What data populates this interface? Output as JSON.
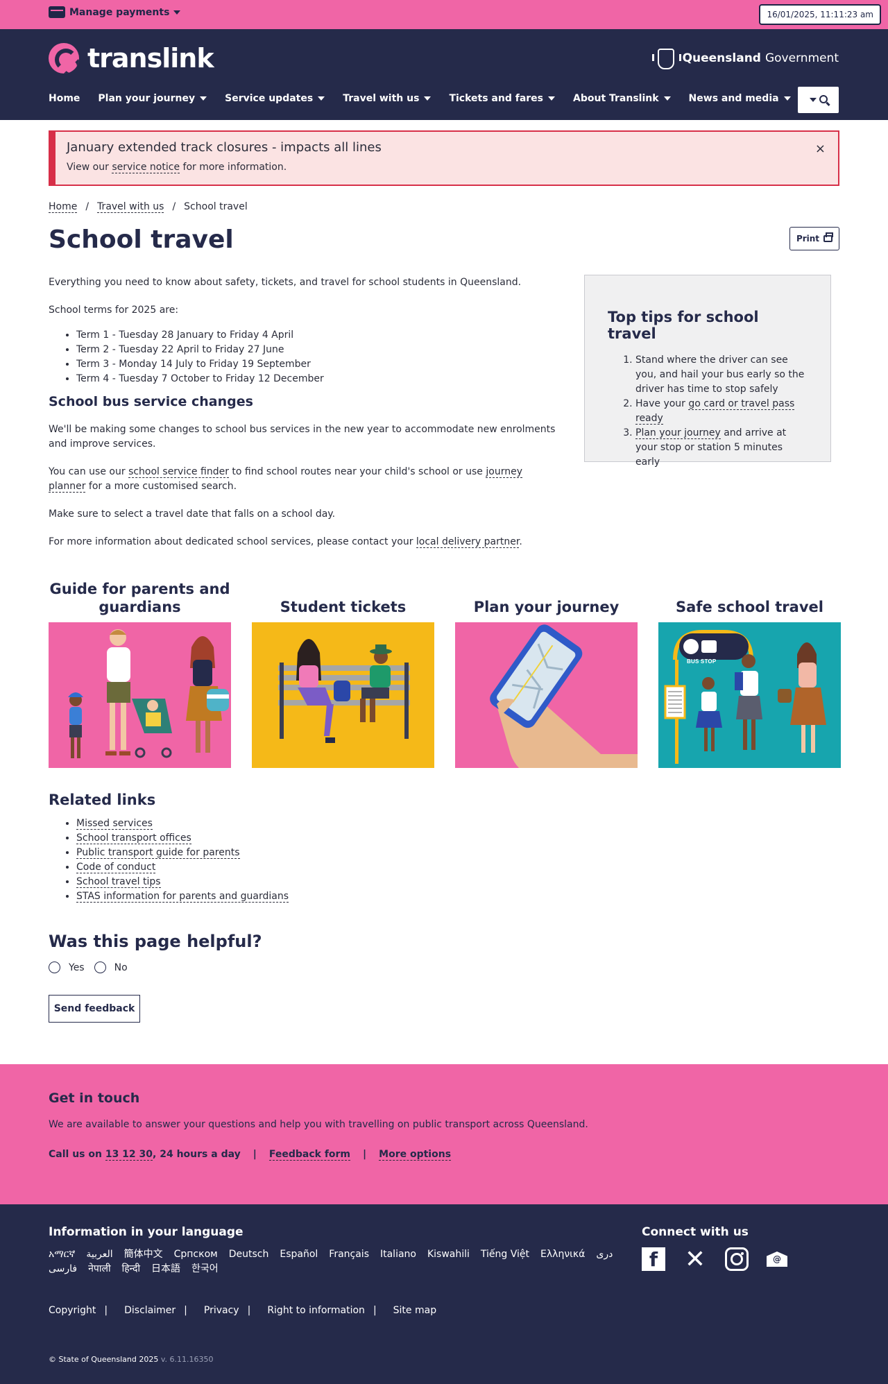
{
  "topbar": {
    "manage_label": "Manage payments",
    "datetime": "16/01/2025, 11:11:23 am"
  },
  "brand": {
    "logo_text": "translink",
    "gov_bold": "Queensland",
    "gov_rest": " Government"
  },
  "nav": {
    "items": [
      {
        "label": "Home"
      },
      {
        "label": "Plan your journey"
      },
      {
        "label": "Service updates"
      },
      {
        "label": "Travel with us"
      },
      {
        "label": "Tickets and fares"
      },
      {
        "label": "About Translink"
      },
      {
        "label": "News and media"
      }
    ]
  },
  "alert": {
    "title": "January extended track closures - impacts all lines",
    "body_before": "View our ",
    "link": "service notice",
    "body_after": " for more information.",
    "close": "×"
  },
  "breadcrumb": {
    "home": "Home",
    "sep1": "/",
    "parent": "Travel with us",
    "sep2": "/",
    "current": "School travel"
  },
  "page": {
    "title": "School travel",
    "print_label": "Print"
  },
  "content": {
    "intro": "Everything you need to know about safety, tickets, and travel for school students in Queensland.",
    "terms_heading": "School terms for 2025 are:",
    "terms": [
      "Term 1 - Tuesday 28 January to Friday 4 April",
      "Term 2 - Tuesday 22 April to Friday 27 June",
      "Term 3 - Monday 14 July to Friday 19 September",
      "Term 4 - Tuesday 7 October to Friday 12 December"
    ],
    "bus_heading": "School bus service changes",
    "bus_p1": "We'll be making some changes to school bus services in the new year to accommodate new enrolments and improve services.",
    "bus_p2_a": "You can use our ",
    "bus_p2_link1": "school service finder",
    "bus_p2_b": " to find school routes near your child's school or use ",
    "bus_p2_link2": "journey planner",
    "bus_p2_c": " for a more customised search.",
    "bus_p3": "Make sure to select a travel date that falls on a school day.",
    "bus_p4_a": "For more information about dedicated school services, please contact your ",
    "bus_p4_link": "local delivery partner",
    "bus_p4_b": "."
  },
  "tips": {
    "title": "Top tips for school travel",
    "tip1": "Stand where the driver can see you, and hail your bus early so the driver has time to stop safely",
    "tip2_a": "Have your ",
    "tip2_link": "go card or travel pass ready",
    "tip3_link": "Plan your journey",
    "tip3_b": " and arrive at your stop or station 5 minutes early"
  },
  "cards": [
    {
      "title": "Guide for parents and guardians"
    },
    {
      "title": "Student tickets"
    },
    {
      "title": "Plan your journey"
    },
    {
      "title": "Safe school travel"
    }
  ],
  "bus_stop_sign": "BUS STOP",
  "related": {
    "heading": "Related links",
    "links": [
      "Missed services",
      "School transport offices",
      "Public transport guide for parents",
      "Code of conduct",
      "School travel tips",
      "STAS information for parents and guardians"
    ]
  },
  "feedback": {
    "heading": "Was this page helpful?",
    "yes": "Yes",
    "no": "No",
    "send": "Send feedback"
  },
  "touch": {
    "heading": "Get in touch",
    "text": "We are available to answer your questions and help you with travelling on public transport across Queensland.",
    "call_a": "Call us on ",
    "call_number": "13 12 30",
    "call_b": ", 24 hours a day",
    "sep": "|",
    "form": "Feedback form",
    "more": "More options"
  },
  "footer": {
    "lang_heading": "Information in your language",
    "languages": [
      "አማርኛ",
      "العربية",
      "簡体中文",
      "Српском",
      "Deutsch",
      "Español",
      "Français",
      "Italiano",
      "Kiswahili",
      "Tiếng Việt",
      "Ελληνικά",
      "دری",
      "فارسی",
      "नेपाली",
      "हिन्दी",
      "日本語",
      "한국어"
    ],
    "connect_heading": "Connect with us",
    "social": [
      "facebook-icon",
      "x-icon",
      "instagram-icon",
      "email-icon"
    ],
    "legal": [
      "Copyright",
      "Disclaimer",
      "Privacy",
      "Right to information",
      "Site map"
    ],
    "legal_sep": "|",
    "copyright": "© State of Queensland 2025",
    "version": " v. 6.11.16350"
  },
  "colors": {
    "pink": "#f065a6",
    "navy": "#252a4a",
    "alert_red": "#d72f48",
    "yellow": "#f5b918",
    "teal": "#17a5ae"
  }
}
